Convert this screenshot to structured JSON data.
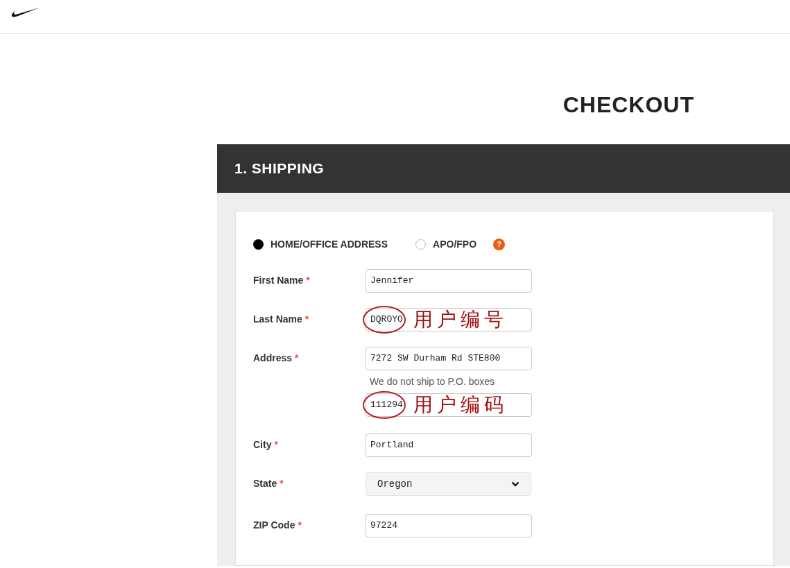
{
  "page_title": "CHECKOUT",
  "section": {
    "title": "1. SHIPPING"
  },
  "address_types": [
    {
      "label": "HOME/OFFICE ADDRESS",
      "selected": true
    },
    {
      "label": "APO/FPO",
      "selected": false
    }
  ],
  "help": "?",
  "fields": [
    {
      "kind": "text",
      "label": "First Name",
      "required": "*",
      "value": "Jennifer"
    },
    {
      "kind": "text",
      "label": "Last Name",
      "required": "*",
      "value": "DQROYO",
      "annotation": "用户编号"
    },
    {
      "kind": "text",
      "label": "Address",
      "required": "*",
      "value": "7272 SW Durham Rd STE800",
      "hint": "We do not ship to P.O. boxes"
    },
    {
      "kind": "text",
      "value": "111294",
      "annotation": "用户编码"
    },
    {
      "kind": "text",
      "label": "City",
      "required": "*",
      "value": "Portland"
    },
    {
      "kind": "select",
      "label": "State",
      "required": "*",
      "value": "Oregon"
    },
    {
      "kind": "text",
      "label": "ZIP Code",
      "required": "*",
      "value": "97224"
    }
  ]
}
